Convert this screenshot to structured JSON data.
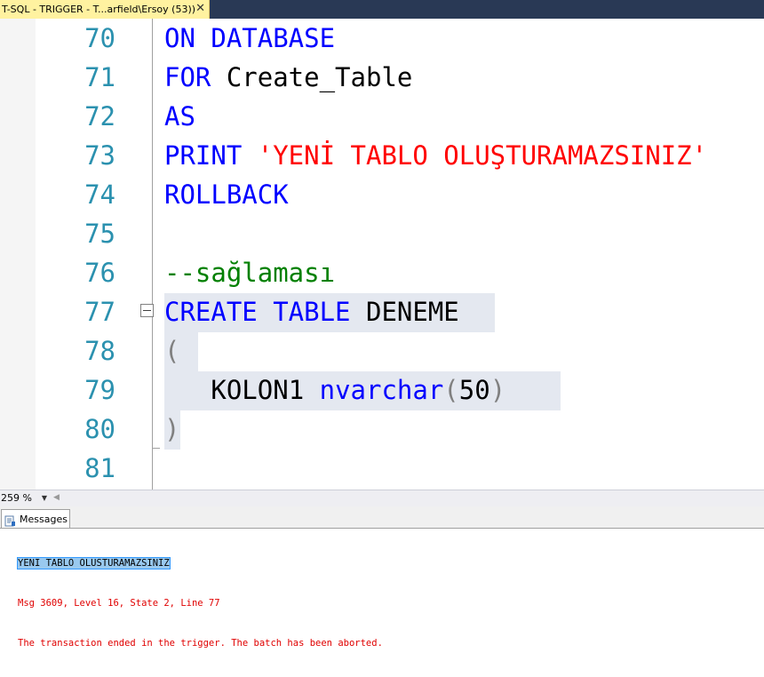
{
  "tab": {
    "title": "T-SQL - TRIGGER - T...arfield\\Ersoy (53))",
    "close": "✕"
  },
  "editor": {
    "lines": [
      {
        "num": "70",
        "tokens": [
          {
            "t": "ON DATABASE",
            "c": "kw"
          }
        ]
      },
      {
        "num": "71",
        "tokens": [
          {
            "t": "FOR ",
            "c": "kw"
          },
          {
            "t": "Create_Table",
            "c": "id"
          }
        ]
      },
      {
        "num": "72",
        "tokens": [
          {
            "t": "AS",
            "c": "kw"
          }
        ]
      },
      {
        "num": "73",
        "tokens": [
          {
            "t": "PRINT ",
            "c": "kw"
          },
          {
            "t": "'YENİ TABLO OLUŞTURAMAZSINIZ'",
            "c": "str"
          }
        ]
      },
      {
        "num": "74",
        "tokens": [
          {
            "t": "ROLLBACK",
            "c": "kw"
          }
        ]
      },
      {
        "num": "75",
        "tokens": []
      },
      {
        "num": "76",
        "tokens": [
          {
            "t": "--sağlaması",
            "c": "cmt"
          }
        ]
      },
      {
        "num": "77",
        "tokens": [
          {
            "t": "CREATE TABLE ",
            "c": "kw"
          },
          {
            "t": "DENEME",
            "c": "id"
          }
        ]
      },
      {
        "num": "78",
        "tokens": [
          {
            "t": "(",
            "c": "gray"
          }
        ]
      },
      {
        "num": "79",
        "tokens": [
          {
            "t": "   ",
            "c": "id"
          },
          {
            "t": "KOLON1 ",
            "c": "id"
          },
          {
            "t": "nvarchar",
            "c": "kw"
          },
          {
            "t": "(",
            "c": "gray"
          },
          {
            "t": "50",
            "c": "id"
          },
          {
            "t": ")",
            "c": "gray"
          }
        ]
      },
      {
        "num": "80",
        "tokens": [
          {
            "t": ")",
            "c": "gray"
          }
        ]
      },
      {
        "num": "81",
        "tokens": []
      }
    ]
  },
  "zoom": {
    "value": "259 %",
    "arrow": "▼"
  },
  "results": {
    "tab_label": "Messages",
    "icon": "messages-icon",
    "messages": [
      "YENI TABLO OLUSTURAMAZSINIZ",
      "Msg 3609, Level 16, State 2, Line 77",
      "The transaction ended in the trigger. The batch has been aborted."
    ]
  }
}
